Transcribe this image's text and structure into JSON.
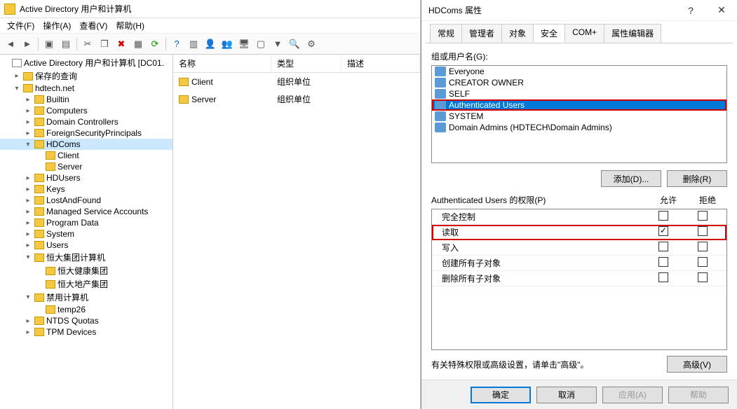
{
  "main": {
    "title": "Active Directory 用户和计算机",
    "menus": [
      "文件(F)",
      "操作(A)",
      "查看(V)",
      "帮助(H)"
    ],
    "list": {
      "headers": [
        "名称",
        "类型",
        "描述"
      ],
      "rows": [
        {
          "name": "Client",
          "type": "组织单位",
          "desc": ""
        },
        {
          "name": "Server",
          "type": "组织单位",
          "desc": ""
        }
      ]
    },
    "tree": [
      {
        "level": 0,
        "chev": "",
        "icon": "root",
        "label": "Active Directory 用户和计算机 [DC01."
      },
      {
        "level": 1,
        "chev": "›",
        "icon": "fi",
        "label": "保存的查询"
      },
      {
        "level": 1,
        "chev": "v",
        "icon": "fi",
        "label": "hdtech.net"
      },
      {
        "level": 2,
        "chev": "›",
        "icon": "fi",
        "label": "Builtin"
      },
      {
        "level": 2,
        "chev": "›",
        "icon": "fi",
        "label": "Computers"
      },
      {
        "level": 2,
        "chev": "›",
        "icon": "fi-ou",
        "label": "Domain Controllers"
      },
      {
        "level": 2,
        "chev": "›",
        "icon": "fi",
        "label": "ForeignSecurityPrincipals"
      },
      {
        "level": 2,
        "chev": "v",
        "icon": "fi-ou",
        "label": "HDComs",
        "selected": true
      },
      {
        "level": 3,
        "chev": "",
        "icon": "fi-ou",
        "label": "Client"
      },
      {
        "level": 3,
        "chev": "",
        "icon": "fi-ou",
        "label": "Server"
      },
      {
        "level": 2,
        "chev": "›",
        "icon": "fi-ou",
        "label": "HDUsers"
      },
      {
        "level": 2,
        "chev": "›",
        "icon": "fi",
        "label": "Keys"
      },
      {
        "level": 2,
        "chev": "›",
        "icon": "fi",
        "label": "LostAndFound"
      },
      {
        "level": 2,
        "chev": "›",
        "icon": "fi",
        "label": "Managed Service Accounts"
      },
      {
        "level": 2,
        "chev": "›",
        "icon": "fi",
        "label": "Program Data"
      },
      {
        "level": 2,
        "chev": "›",
        "icon": "fi",
        "label": "System"
      },
      {
        "level": 2,
        "chev": "›",
        "icon": "fi",
        "label": "Users"
      },
      {
        "level": 2,
        "chev": "v",
        "icon": "fi-ou",
        "label": "恒大集团计算机"
      },
      {
        "level": 3,
        "chev": "",
        "icon": "fi-ou",
        "label": "恒大健康集团"
      },
      {
        "level": 3,
        "chev": "",
        "icon": "fi-ou",
        "label": "恒大地产集团"
      },
      {
        "level": 2,
        "chev": "v",
        "icon": "fi-ou",
        "label": "禁用计算机"
      },
      {
        "level": 3,
        "chev": "",
        "icon": "fi-ou",
        "label": "temp26"
      },
      {
        "level": 2,
        "chev": "›",
        "icon": "fi",
        "label": "NTDS Quotas"
      },
      {
        "level": 2,
        "chev": "›",
        "icon": "fi",
        "label": "TPM Devices"
      }
    ]
  },
  "dialog": {
    "title": "HDComs 属性",
    "tabs": [
      "常规",
      "管理者",
      "对象",
      "安全",
      "COM+",
      "属性编辑器"
    ],
    "active_tab": 3,
    "groups_label": "组或用户名(G):",
    "groups": [
      {
        "name": "Everyone"
      },
      {
        "name": "CREATOR OWNER"
      },
      {
        "name": "SELF"
      },
      {
        "name": "Authenticated Users",
        "selected": true,
        "hilite": true
      },
      {
        "name": "SYSTEM"
      },
      {
        "name": "Domain Admins (HDTECH\\Domain Admins)"
      }
    ],
    "btn_add": "添加(D)...",
    "btn_remove": "删除(R)",
    "perms_label": "Authenticated Users 的权限(P)",
    "col_allow": "允许",
    "col_deny": "拒绝",
    "perms": [
      {
        "name": "完全控制",
        "allow": false,
        "deny": false
      },
      {
        "name": "读取",
        "allow": true,
        "deny": false,
        "hilite": true
      },
      {
        "name": "写入",
        "allow": false,
        "deny": false
      },
      {
        "name": "创建所有子对象",
        "allow": false,
        "deny": false
      },
      {
        "name": "删除所有子对象",
        "allow": false,
        "deny": false
      }
    ],
    "adv_text": "有关特殊权限或高级设置，请单击\"高级\"。",
    "btn_advanced": "高级(V)",
    "btn_ok": "确定",
    "btn_cancel": "取消",
    "btn_apply": "应用(A)",
    "btn_help": "帮助"
  }
}
